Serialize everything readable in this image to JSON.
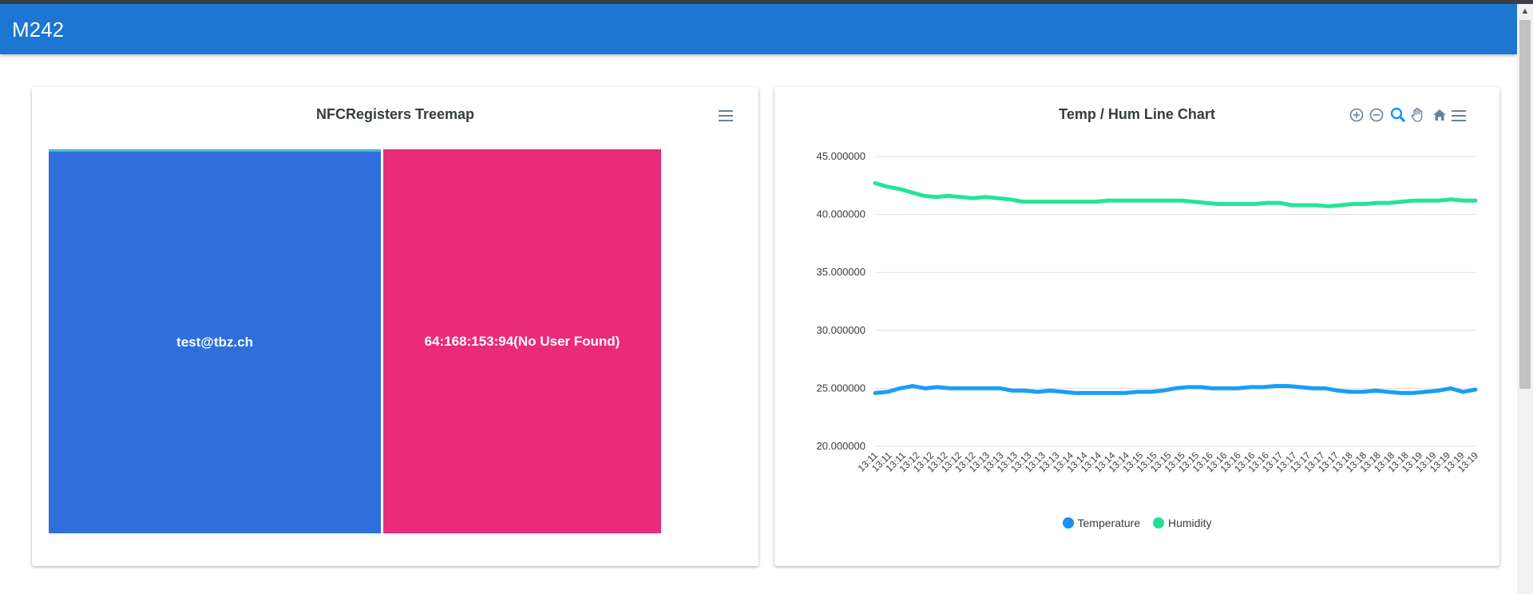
{
  "app": {
    "title": "M242"
  },
  "treemap": {
    "title": "NFCRegisters Treemap",
    "colors": {
      "a": "#2e6fdb",
      "b": "#ea2b79",
      "strip": "#4bb8c9"
    },
    "items": [
      {
        "label": "test@tbz.ch"
      },
      {
        "label": "64:168:153:94(No User Found)"
      }
    ]
  },
  "linechart": {
    "title": "Temp / Hum Line Chart",
    "toolbar": [
      "zoom-in-icon",
      "zoom-out-icon",
      "selection-zoom-icon",
      "pan-hand-icon",
      "home-reset-icon",
      "menu-icon"
    ]
  },
  "chart_data": {
    "type": "line",
    "title": "Temp / Hum Line Chart",
    "ylim": [
      20,
      45
    ],
    "y_ticks": [
      "45.000000",
      "40.000000",
      "35.000000",
      "30.000000",
      "25.000000",
      "20.000000"
    ],
    "grid": true,
    "legend_position": "bottom",
    "categories": [
      "13:11",
      "13:11",
      "13:11",
      "13:12",
      "13:12",
      "13:12",
      "13:12",
      "13:12",
      "13:13",
      "13:13",
      "13:13",
      "13:13",
      "13:13",
      "13:13",
      "13:14",
      "13:14",
      "13:14",
      "13:14",
      "13:14",
      "13:15",
      "13:15",
      "13:15",
      "13:15",
      "13:15",
      "13:16",
      "13:16",
      "13:16",
      "13:16",
      "13:16",
      "13:17",
      "13:17",
      "13:17",
      "13:17",
      "13:17",
      "13:18",
      "13:18",
      "13:18",
      "13:18",
      "13:18",
      "13:19",
      "13:19",
      "13:19",
      "13:19",
      "13:19"
    ],
    "series": [
      {
        "name": "Temperature",
        "color": "#1a9ef5",
        "values": [
          24.6,
          24.7,
          25.0,
          25.2,
          25.0,
          25.1,
          25.0,
          25.0,
          25.0,
          25.0,
          25.0,
          24.8,
          24.8,
          24.7,
          24.8,
          24.7,
          24.6,
          24.6,
          24.6,
          24.6,
          24.6,
          24.7,
          24.7,
          24.8,
          25.0,
          25.1,
          25.1,
          25.0,
          25.0,
          25.0,
          25.1,
          25.1,
          25.2,
          25.2,
          25.1,
          25.0,
          25.0,
          24.8,
          24.7,
          24.7,
          24.8,
          24.7,
          24.6,
          24.6,
          24.7,
          24.8,
          25.0,
          24.7,
          24.9
        ]
      },
      {
        "name": "Humidity",
        "color": "#27e396",
        "values": [
          42.7,
          42.4,
          42.2,
          41.9,
          41.6,
          41.5,
          41.6,
          41.5,
          41.4,
          41.5,
          41.4,
          41.3,
          41.1,
          41.1,
          41.1,
          41.1,
          41.1,
          41.1,
          41.1,
          41.2,
          41.2,
          41.2,
          41.2,
          41.2,
          41.2,
          41.2,
          41.1,
          41.0,
          40.9,
          40.9,
          40.9,
          40.9,
          41.0,
          41.0,
          40.8,
          40.8,
          40.8,
          40.7,
          40.8,
          40.9,
          40.9,
          41.0,
          41.0,
          41.1,
          41.2,
          41.2,
          41.2,
          41.3,
          41.2,
          41.2
        ]
      }
    ]
  }
}
